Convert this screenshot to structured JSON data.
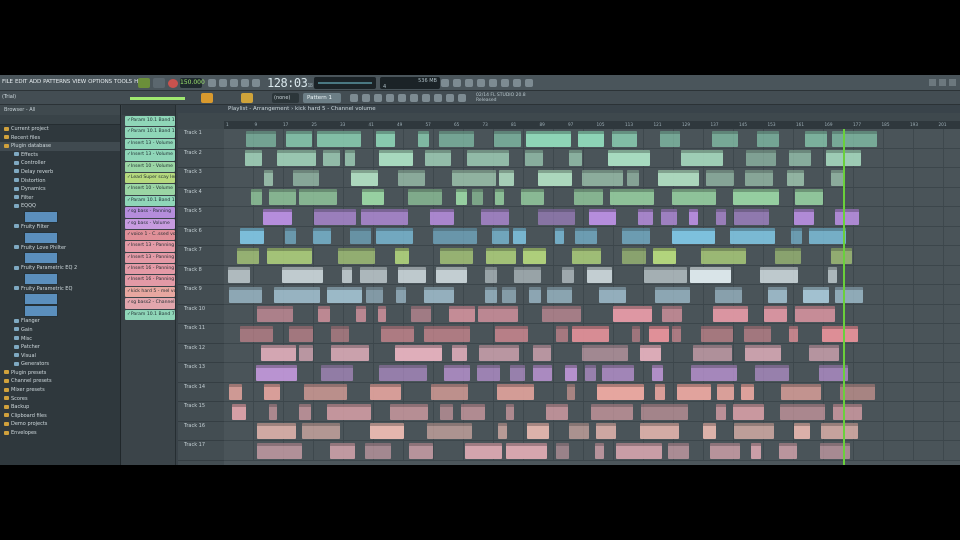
{
  "menu": [
    "FILE",
    "EDIT",
    "ADD",
    "PATTERNS",
    "VIEW",
    "OPTIONS",
    "TOOLS",
    "HELP"
  ],
  "transport": {
    "tempo": "150.000",
    "time": "128:03",
    "time_sub": "18"
  },
  "cpu": {
    "line1": "536 MB",
    "line2": "4"
  },
  "hint": "(Trial)",
  "toolbar": {
    "snap": "(none)",
    "pattern": "Pattern 1"
  },
  "news": {
    "line1": "02/14  FL STUDIO 20.8",
    "line2": "Released"
  },
  "browser": {
    "header": "Browser - All",
    "items": [
      {
        "label": "Current project",
        "type": "cat"
      },
      {
        "label": "Recent files",
        "type": "cat"
      },
      {
        "label": "Plugin database",
        "type": "cat"
      },
      {
        "label": "Effects",
        "type": "sub"
      },
      {
        "label": "Controller",
        "type": "sub"
      },
      {
        "label": "Delay reverb",
        "type": "sub"
      },
      {
        "label": "Distortion",
        "type": "sub"
      },
      {
        "label": "Dynamics",
        "type": "sub"
      },
      {
        "label": "Filter",
        "type": "sub"
      },
      {
        "label": "EQQQ",
        "type": "sub"
      },
      {
        "label": "",
        "type": "thumb"
      },
      {
        "label": "Fruity Filter",
        "type": "sub"
      },
      {
        "label": "",
        "type": "thumb"
      },
      {
        "label": "Fruity Love Philter",
        "type": "sub"
      },
      {
        "label": "",
        "type": "thumb"
      },
      {
        "label": "Fruity Parametric EQ 2",
        "type": "sub"
      },
      {
        "label": "",
        "type": "thumb"
      },
      {
        "label": "Fruity Parametric EQ",
        "type": "sub"
      },
      {
        "label": "",
        "type": "thumb"
      },
      {
        "label": "",
        "type": "thumb"
      },
      {
        "label": "Flanger",
        "type": "sub"
      },
      {
        "label": "Gain",
        "type": "sub"
      },
      {
        "label": "Misc",
        "type": "sub"
      },
      {
        "label": "Patcher",
        "type": "sub"
      },
      {
        "label": "Visual",
        "type": "sub"
      },
      {
        "label": "Generators",
        "type": "sub"
      },
      {
        "label": "Plugin presets",
        "type": "cat"
      },
      {
        "label": "Channel presets",
        "type": "cat"
      },
      {
        "label": "Mixer presets",
        "type": "cat"
      },
      {
        "label": "Scores",
        "type": "cat"
      },
      {
        "label": "Backup",
        "type": "cat"
      },
      {
        "label": "Clipboard files",
        "type": "cat"
      },
      {
        "label": "Demo projects",
        "type": "cat"
      },
      {
        "label": "Envelopes",
        "type": "cat"
      }
    ]
  },
  "channels": [
    {
      "label": "Param 10.1 Band 1 freq",
      "color": "#8fd6b8"
    },
    {
      "label": "Param 10.1 Band 1 freq",
      "color": "#8fd6b8"
    },
    {
      "label": "Insert 13 - Volume",
      "color": "#8fd6b8"
    },
    {
      "label": "Insert 13 - Volume",
      "color": "#8fd6b8"
    },
    {
      "label": "Insert 10 - Volume",
      "color": "#9ad5a4"
    },
    {
      "label": "Lead Super scay length",
      "color": "#b6d97e"
    },
    {
      "label": "Insert 10 - Volume",
      "color": "#9ad5a4"
    },
    {
      "label": "Param 10.1 Band 1 freq",
      "color": "#8fd6b8"
    },
    {
      "label": "sg bass - Panning",
      "color": "#b58ddc"
    },
    {
      "label": "sg bass - Volume",
      "color": "#c79be0"
    },
    {
      "label": "voice 1 - C..ssed volume",
      "color": "#e09098"
    },
    {
      "label": "Insert 13 - Panning",
      "color": "#e39aa6"
    },
    {
      "label": "Insert 13 - Panning",
      "color": "#e39aa6"
    },
    {
      "label": "Insert 16 - Panning",
      "color": "#e39aa6"
    },
    {
      "label": "Insert 16 - Panning",
      "color": "#e39aa6"
    },
    {
      "label": "kick hard 5 - mel volume",
      "color": "#e8a7a0"
    },
    {
      "label": "sg bass2 - Channel pitch",
      "color": "#e2a6ad"
    },
    {
      "label": "Param 10.1 Band 7 freq",
      "color": "#8fd6b8"
    }
  ],
  "playlist": {
    "title": "Playlist - Arrangement › kick hard 5 - Channel volume",
    "ruler": [
      "1",
      "9",
      "17",
      "25",
      "33",
      "41",
      "49",
      "57",
      "65",
      "73",
      "81",
      "89",
      "97",
      "105",
      "113",
      "121",
      "129",
      "137",
      "145",
      "153",
      "161",
      "169",
      "177",
      "185",
      "193",
      "201"
    ],
    "tracks": [
      "Track 1",
      "Track 2",
      "Track 3",
      "Track 4",
      "Track 5",
      "Track 6",
      "Track 7",
      "Track 8",
      "Track 9",
      "Track 10",
      "Track 11",
      "Track 12",
      "Track 13",
      "Track 14",
      "Track 15",
      "Track 16",
      "Track 17"
    ]
  },
  "colors": {
    "accent": "#9fe870",
    "playhead": "#6ad03c"
  }
}
